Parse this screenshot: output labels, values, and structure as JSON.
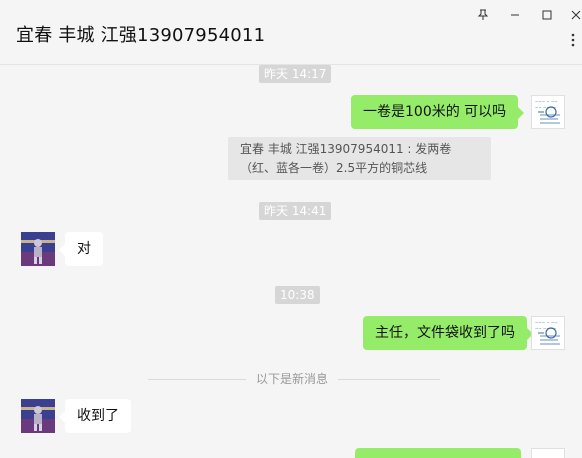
{
  "window": {
    "title": "宜春 丰城 江强13907954011",
    "pin_icon": "pin-icon",
    "minimize_icon": "minimize-icon",
    "maximize_icon": "maximize-icon",
    "close_icon": "close-icon",
    "more_icon": "more-icon"
  },
  "messages": {
    "t1": "昨天 14:17",
    "m1": "一卷是100米的   可以吗",
    "sys1": "宜春 丰城 江强13907954011 : 发两卷（红、蓝各一卷）2.5平方的铜芯线",
    "t2": "昨天 14:41",
    "m2": "对",
    "t3": "10:38",
    "m3": "主任，文件袋收到了吗",
    "divider": "以下是新消息",
    "m4": "收到了"
  },
  "colors": {
    "my_bubble": "#95ec69",
    "their_bubble": "#ffffff",
    "background": "#f5f5f5"
  }
}
